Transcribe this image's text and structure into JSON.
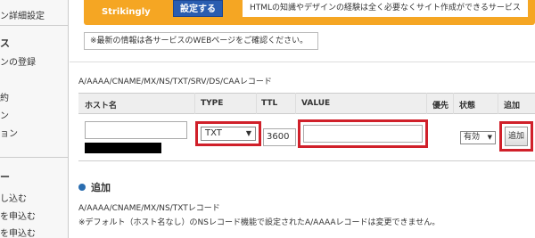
{
  "sidebar": {
    "items": [
      {
        "label": "ン詳細設定",
        "type": "item"
      },
      {
        "label": "ス",
        "type": "head"
      },
      {
        "label": "ンの登録",
        "type": "item"
      },
      {
        "label": "約",
        "type": "item"
      },
      {
        "label": "ン",
        "type": "item"
      },
      {
        "label": "ョン",
        "type": "item"
      },
      {
        "label": "ー",
        "type": "head"
      },
      {
        "label": "し込む",
        "type": "item"
      },
      {
        "label": "を申込む",
        "type": "item"
      },
      {
        "label": "を申込む",
        "type": "item"
      }
    ]
  },
  "promo": {
    "service_name": "Strikingly",
    "button_label": "設定する",
    "description": "HTMLの知識やデザインの経験は全く必要なくサイト作成ができるサービス"
  },
  "notice": "※最新の情報は各サービスのWEBページをご確認ください。",
  "records": {
    "section_title": "A/AAAA/CNAME/MX/NS/TXT/SRV/DS/CAAレコード",
    "headers": {
      "host": "ホスト名",
      "type": "TYPE",
      "ttl": "TTL",
      "value": "VALUE",
      "priority": "優先",
      "status": "状態",
      "add": "追加"
    },
    "row": {
      "host_value": "",
      "type_value": "TXT",
      "ttl_value": "3600",
      "value_value": "",
      "status_value": "有効",
      "add_button": "追加"
    }
  },
  "add_section": {
    "heading": "追加",
    "subtitle": "A/AAAA/CNAME/MX/NS/TXTレコード",
    "note": "※デフォルト（ホスト名なし）のNSレコード機能で設定されたA/AAAAレコードは変更できません。"
  },
  "colors": {
    "promo_bg": "#f5a623",
    "promo_button": "#2a5db0",
    "highlight": "#d0202a",
    "bullet": "#2a6db0"
  }
}
